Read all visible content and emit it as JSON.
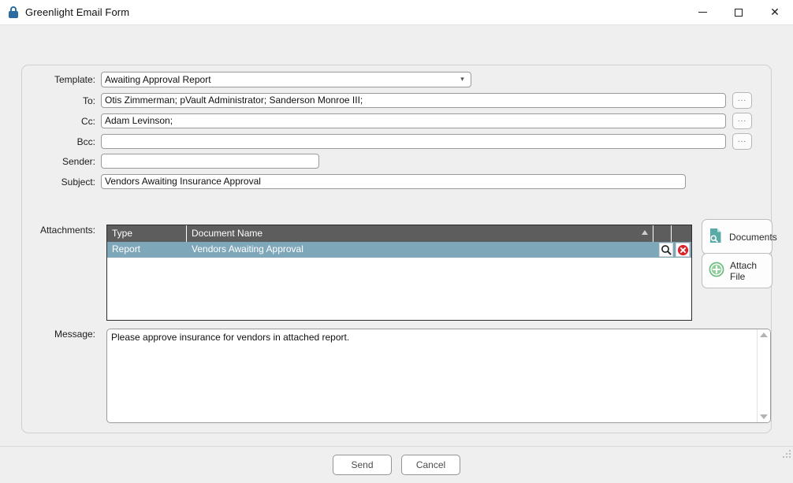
{
  "window": {
    "title": "Greenlight Email Form",
    "lock_icon": "lock-icon",
    "minimize": "minimize",
    "maximize": "maximize",
    "close": "close"
  },
  "form": {
    "template": {
      "label": "Template:",
      "value": "Awaiting Approval Report",
      "dropdown_icon": "chevron-down-icon"
    },
    "to": {
      "label": "To:",
      "value": "Otis Zimmerman; pVault Administrator; Sanderson Monroe III;",
      "browse_label": "..."
    },
    "cc": {
      "label": "Cc:",
      "value": "Adam Levinson;",
      "browse_label": "..."
    },
    "bcc": {
      "label": "Bcc:",
      "value": "",
      "browse_label": "..."
    },
    "sender": {
      "label": "Sender:",
      "value": ""
    },
    "subject": {
      "label": "Subject:",
      "value": "Vendors Awaiting Insurance Approval"
    },
    "attachments": {
      "label": "Attachments:",
      "columns": [
        "Type",
        "Document Name",
        "",
        ""
      ],
      "sort_indicator": "ascending",
      "rows": [
        {
          "type": "Report",
          "name": "Vendors Awaiting Approval",
          "selected": true,
          "view_icon": "magnifier-icon",
          "delete_icon": "delete-circle-icon"
        }
      ]
    },
    "message": {
      "label": "Message:",
      "value": "Please approve insurance for vendors in attached report."
    }
  },
  "side_buttons": [
    {
      "label": "Documents",
      "icon": "document-search-icon"
    },
    {
      "label": "Attach File",
      "icon": "plus-circle-icon"
    }
  ],
  "footer": {
    "send_label": "Send",
    "cancel_label": "Cancel"
  },
  "colors": {
    "selection": "#7fa7ba",
    "grid_header": "#5d5d5d",
    "accent_teal": "#55a8a8",
    "accent_green": "#6bbf7b",
    "delete_red": "#d9252a",
    "lock_blue": "#2b6ca3"
  }
}
